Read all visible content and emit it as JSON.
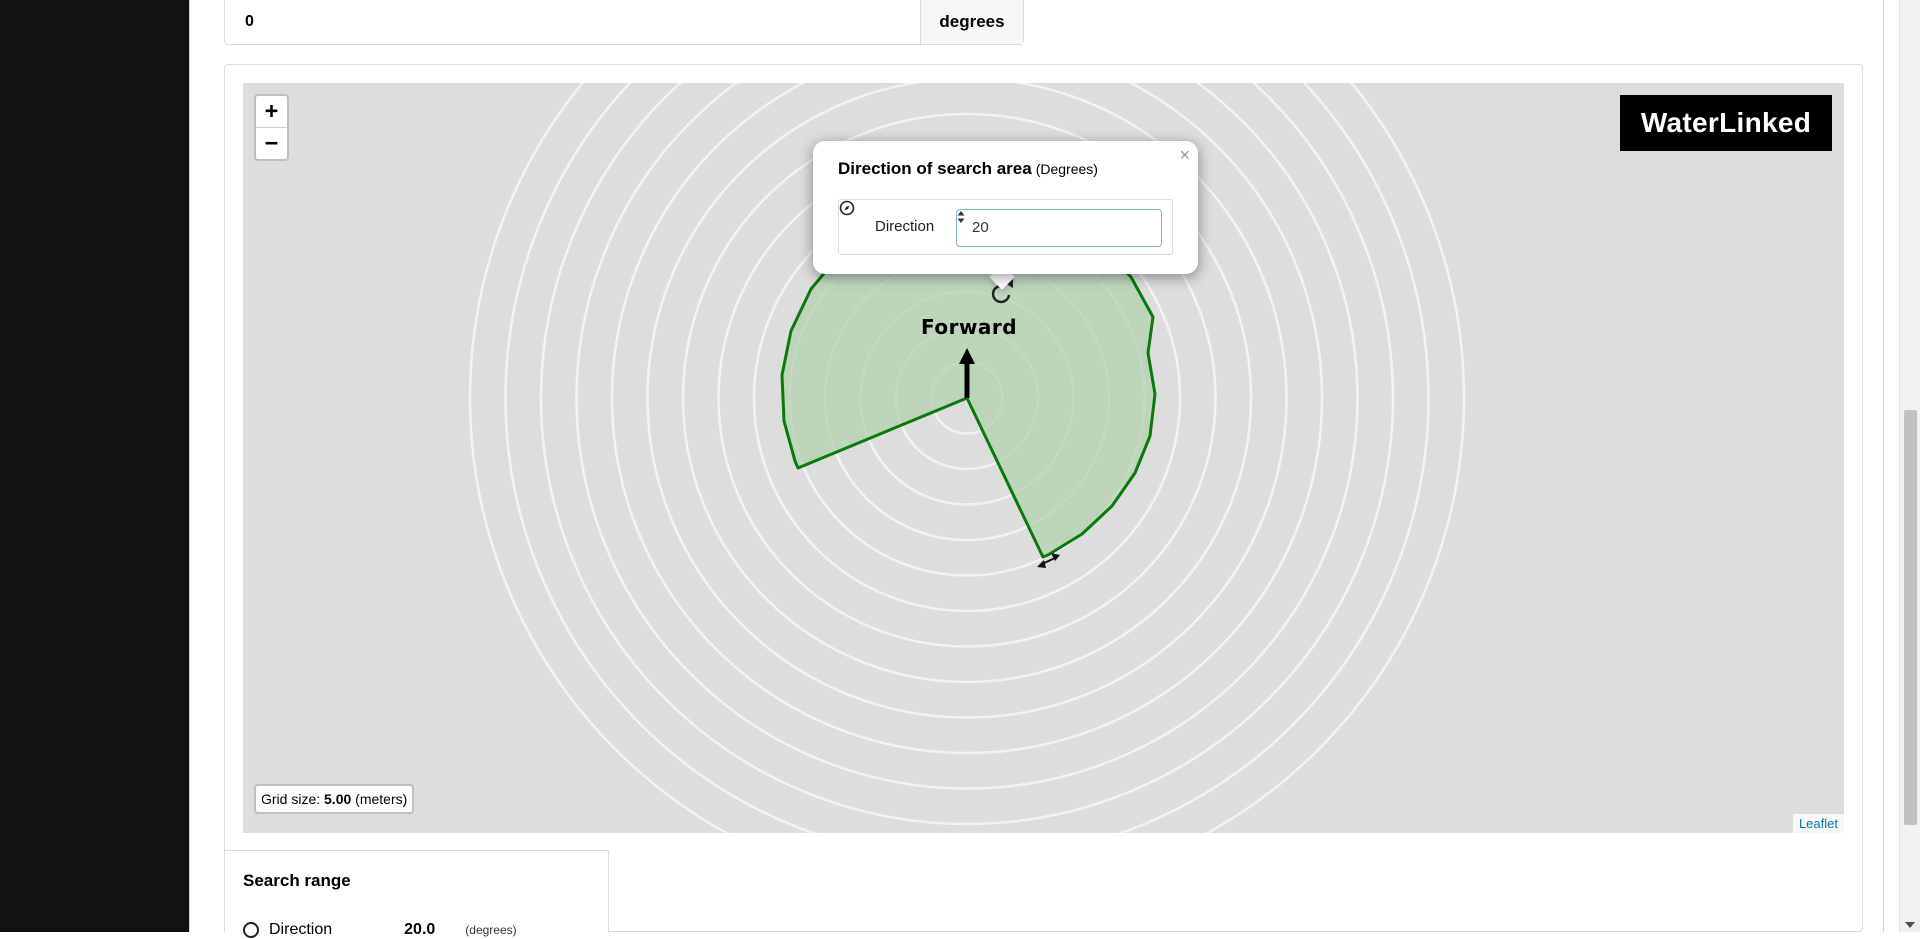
{
  "top_input": {
    "value": "0",
    "suffix": "degrees"
  },
  "map": {
    "zoom_in": "+",
    "zoom_out": "−",
    "logo_text": "WaterLinked",
    "forward_label": "Forward",
    "grid_size_prefix": "Grid size:",
    "grid_size_value": "5.00",
    "grid_size_unit": "(meters)",
    "attribution": "Leaflet",
    "sector_fill": "#b3d2b0",
    "sector_stroke": "#0a7a0a",
    "ring_color": "#f2f2f2",
    "background": "#dddddd"
  },
  "popup": {
    "title": "Direction of search area",
    "title_unit": "(Degrees)",
    "close": "×",
    "label": "Direction",
    "input_value": "20",
    "icon": "compass-icon"
  },
  "search_range": {
    "title": "Search range",
    "direction_label": "Direction",
    "direction_value": "20.0",
    "direction_unit": "(degrees)"
  }
}
